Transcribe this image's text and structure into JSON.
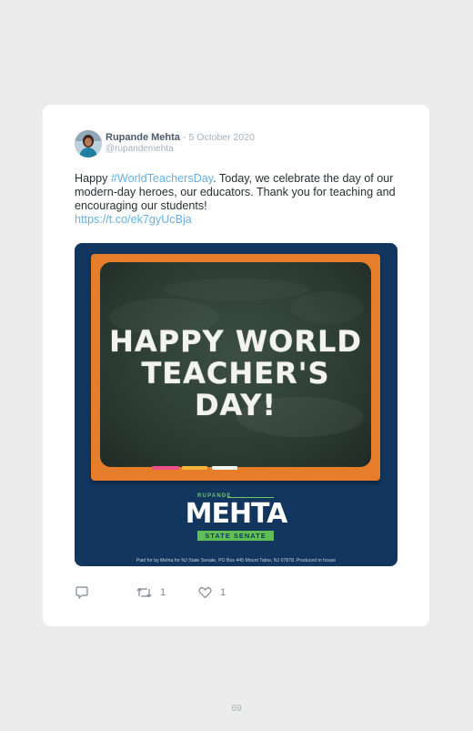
{
  "tweet": {
    "author_name": "Rupande Mehta",
    "separator": "-",
    "date": "5 October 2020",
    "handle": "@rupandemehta",
    "text_before": "Happy ",
    "hashtag": "#WorldTeachersDay",
    "text_after": ". Today, we celebrate the day of our modern-day heroes, our educators. Thank you for teaching and encouraging our students!",
    "link": "https://t.co/ek7gyUcBja"
  },
  "media": {
    "board_line1": "HAPPY WORLD",
    "board_line2": "TEACHER'S",
    "board_line3": "DAY!",
    "logo_sub": "RUPANDE",
    "logo_main": "MEHTA",
    "logo_badge": "STATE SENATE",
    "disclaimer": "Paid for by Mehta for NJ State Senate, PO Box 445 Mount Tabor, NJ 07878. Produced in house"
  },
  "actions": {
    "reply_icon": "reply-icon",
    "retweet_icon": "retweet-icon",
    "retweet_count": "1",
    "like_icon": "heart-icon",
    "like_count": "1"
  },
  "page": {
    "number": "69"
  },
  "colors": {
    "accent_link": "#65b0e6",
    "media_background": "#12365d",
    "frame_orange": "#e57d2b",
    "logo_green": "#5fbf54"
  }
}
